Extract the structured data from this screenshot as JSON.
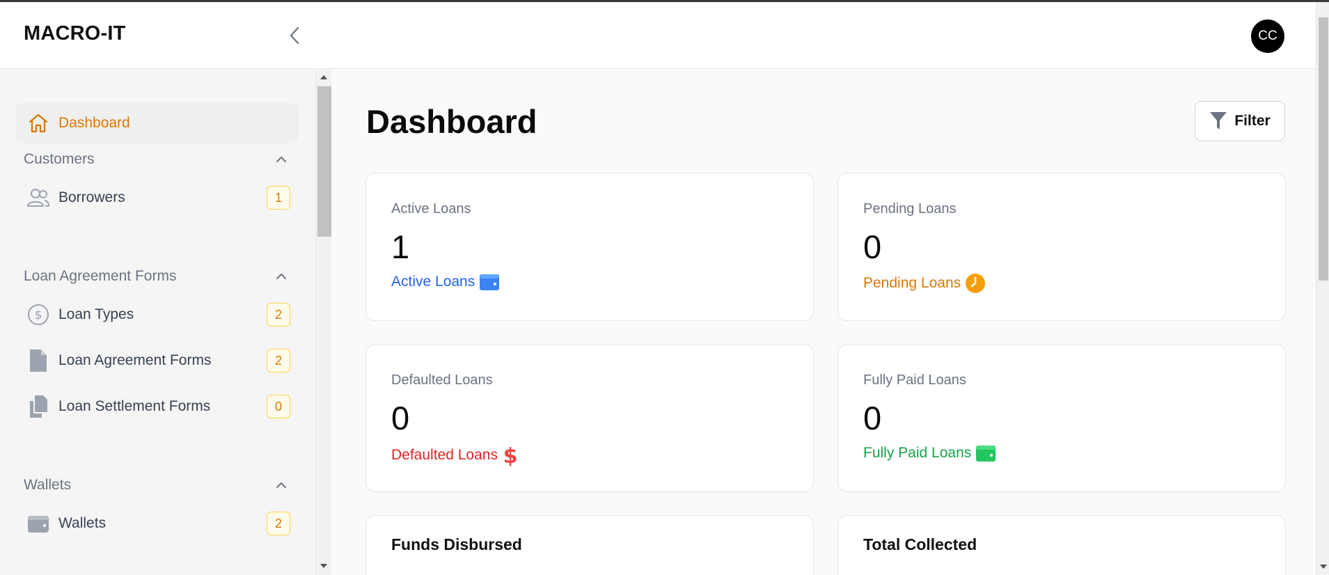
{
  "header": {
    "brand": "MACRO-IT",
    "avatar_initials": "CC"
  },
  "sidebar": {
    "active_item": {
      "label": "Dashboard",
      "icon": "home-icon"
    },
    "sections": [
      {
        "title": "Customers",
        "items": [
          {
            "label": "Borrowers",
            "icon": "users-icon",
            "count": "1"
          }
        ]
      },
      {
        "title": "Loan Agreement Forms",
        "items": [
          {
            "label": "Loan Types",
            "icon": "dollar-circle-icon",
            "count": "2"
          },
          {
            "label": "Loan Agreement Forms",
            "icon": "file-icon",
            "count": "2"
          },
          {
            "label": "Loan Settlement Forms",
            "icon": "copy-icon",
            "count": "0"
          }
        ]
      },
      {
        "title": "Wallets",
        "items": [
          {
            "label": "Wallets",
            "icon": "wallet-icon",
            "count": "2"
          }
        ]
      }
    ]
  },
  "main": {
    "title": "Dashboard",
    "filter_label": "Filter",
    "cards": [
      {
        "label": "Active Loans",
        "value": "1",
        "link": "Active Loans",
        "icon": "wallet-icon",
        "color": "#2563eb"
      },
      {
        "label": "Pending Loans",
        "value": "0",
        "link": "Pending Loans",
        "icon": "clock-icon",
        "color": "#d97706"
      },
      {
        "label": "Defaulted Loans",
        "value": "0",
        "link": "Defaulted Loans",
        "icon": "dollar-icon",
        "color": "#dc2626"
      },
      {
        "label": "Fully Paid Loans",
        "value": "0",
        "link": "Fully Paid Loans",
        "icon": "wallet-icon",
        "color": "#16a34a"
      }
    ],
    "summary_cards": [
      {
        "title": "Funds Disbursed"
      },
      {
        "title": "Total Collected"
      }
    ]
  },
  "colors": {
    "accent": "#d97706",
    "active_blue": "#2563eb",
    "pending_orange": "#f59e0b",
    "defaulted_red": "#dc2626",
    "paid_green": "#16a34a"
  }
}
